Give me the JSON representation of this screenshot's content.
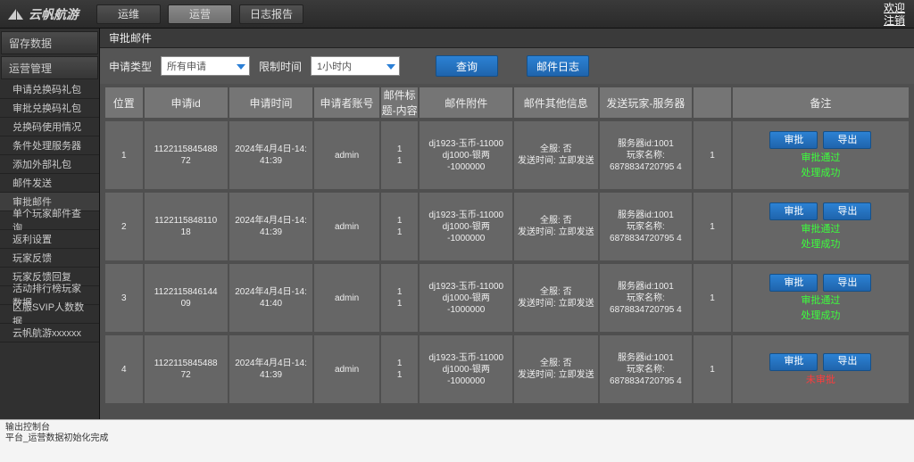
{
  "header": {
    "logo_text": "云帆航游",
    "tabs": [
      "运维",
      "运营",
      "日志报告"
    ],
    "active_tab": 1,
    "welcome": "欢迎",
    "logout": "注销"
  },
  "sidebar": {
    "groups": [
      {
        "title": "留存数据",
        "items": []
      },
      {
        "title": "运营管理",
        "items": [
          "申请兑换码礼包",
          "审批兑换码礼包",
          "兑换码使用情况",
          "条件处理服务器",
          "添加外部礼包",
          "邮件发送",
          "审批邮件",
          "单个玩家邮件查询",
          "返利设置",
          "玩家反馈",
          "玩家反馈回复",
          "活动排行榜玩家数据",
          "区服SVIP人数数据",
          "云帆航游xxxxxx"
        ],
        "selected": 6
      }
    ]
  },
  "breadcrumb": "审批邮件",
  "filters": {
    "type_label": "申请类型",
    "type_value": "所有申请",
    "limit_label": "限制时间",
    "limit_value": "1小时内",
    "query_btn": "查询",
    "log_btn": "邮件日志"
  },
  "table": {
    "headers": [
      "位置",
      "申请id",
      "申请时间",
      "申请者账号",
      "邮件标题-内容",
      "邮件附件",
      "邮件其他信息",
      "发送玩家-服务器",
      "",
      "备注"
    ],
    "col_widths": [
      "40",
      "90",
      "90",
      "70",
      "40",
      "100",
      "90",
      "100",
      "40",
      "190"
    ],
    "btn_approve": "审批",
    "btn_export": "导出",
    "status_pass": "审批通过",
    "status_ok": "处理成功",
    "status_pending": "未审批",
    "rows": [
      {
        "pos": "1",
        "id": "1122115845488\n72",
        "time": "2024年4月4日-14:\n41:39",
        "acct": "admin",
        "title": "1\n1",
        "attach": "dj1923-玉币-11000\ndj1000-银两\n-1000000",
        "other": "全服: 否\n发送时间: 立即发送",
        "target": "服务器id:1001\n玩家名称:\n6878834720795 4",
        "flag": "1",
        "status": "pass"
      },
      {
        "pos": "2",
        "id": "1122115848110\n18",
        "time": "2024年4月4日-14:\n41:39",
        "acct": "admin",
        "title": "1\n1",
        "attach": "dj1923-玉币-11000\ndj1000-银两\n-1000000",
        "other": "全服: 否\n发送时间: 立即发送",
        "target": "服务器id:1001\n玩家名称:\n6878834720795 4",
        "flag": "1",
        "status": "pass"
      },
      {
        "pos": "3",
        "id": "1122115846144\n09",
        "time": "2024年4月4日-14:\n41:40",
        "acct": "admin",
        "title": "1\n1",
        "attach": "dj1923-玉币-11000\ndj1000-银两\n-1000000",
        "other": "全服: 否\n发送时间: 立即发送",
        "target": "服务器id:1001\n玩家名称:\n6878834720795 4",
        "flag": "1",
        "status": "pass"
      },
      {
        "pos": "4",
        "id": "1122115845488\n72",
        "time": "2024年4月4日-14:\n41:39",
        "acct": "admin",
        "title": "1\n1",
        "attach": "dj1923-玉币-11000\ndj1000-银两\n-1000000",
        "other": "全服: 否\n发送时间: 立即发送",
        "target": "服务器id:1001\n玩家名称:\n6878834720795 4",
        "flag": "1",
        "status": "pending"
      }
    ]
  },
  "footer": {
    "line1": "输出控制台",
    "line2": "平台_运营数据初始化完成"
  }
}
